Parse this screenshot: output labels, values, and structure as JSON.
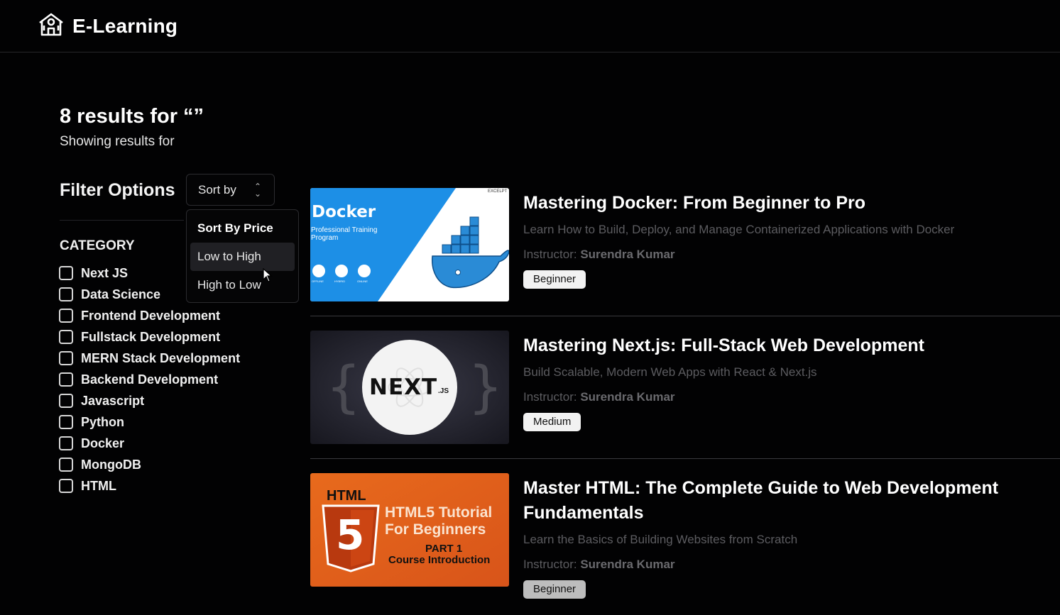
{
  "app": {
    "title": "E-Learning",
    "logo_icon": "school-building-icon"
  },
  "results": {
    "title": "8 results for “”",
    "subtitle": "Showing results for"
  },
  "filters": {
    "title": "Filter Options",
    "sort_button": {
      "label": "Sort by",
      "icon": "chevron-up-down-icon"
    },
    "dropdown": {
      "group_label": "Sort By Price",
      "options": [
        "Low to High",
        "High to Low"
      ],
      "highlighted": "Low to High"
    },
    "category_title": "CATEGORY",
    "categories": [
      {
        "label": "Next JS",
        "checked": false
      },
      {
        "label": "Data Science",
        "checked": false
      },
      {
        "label": "Frontend Development",
        "checked": false
      },
      {
        "label": "Fullstack Development",
        "checked": false
      },
      {
        "label": "MERN Stack Development",
        "checked": false
      },
      {
        "label": "Backend Development",
        "checked": false
      },
      {
        "label": "Javascript",
        "checked": false
      },
      {
        "label": "Python",
        "checked": false
      },
      {
        "label": "Docker",
        "checked": false
      },
      {
        "label": "MongoDB",
        "checked": false
      },
      {
        "label": "HTML",
        "checked": false
      }
    ]
  },
  "courses": [
    {
      "title": "Mastering Docker: From Beginner to Pro",
      "description": "Learn How to Build, Deploy, and Manage Containerized Applications with Docker",
      "instructor_prefix": "Instructor:",
      "instructor": "Surendra Kumar",
      "level": "Beginner",
      "thumb": {
        "heading": "Docker",
        "sub": "Professional Training Program",
        "corner": "EXCELPT",
        "icons": [
          "OFFLINE",
          "HYBRID",
          "ONLINE"
        ]
      }
    },
    {
      "title": "Mastering Next.js: Full-Stack Web Development",
      "description": "Build Scalable, Modern Web Apps with React & Next.js",
      "instructor_prefix": "Instructor:",
      "instructor": "Surendra Kumar",
      "level": "Medium",
      "thumb": {
        "logo": "NEXT",
        "logo_suffix": ".JS"
      }
    },
    {
      "title": "Master HTML: The Complete Guide to Web Development Fundamentals",
      "description": "Learn the Basics of Building Websites from Scratch",
      "instructor_prefix": "Instructor:",
      "instructor": "Surendra Kumar",
      "level": "Beginner",
      "thumb": {
        "tag": "HTML",
        "shield_num": "5",
        "line1": "HTML5 Tutorial",
        "line2": "For Beginners",
        "line3": "PART 1",
        "line4": "Course Introduction"
      }
    }
  ],
  "colors": {
    "background": "#020203",
    "docker_blue": "#1d8fe6",
    "html_orange": "#e8621e",
    "badge_bg": "#f2f2f2"
  }
}
